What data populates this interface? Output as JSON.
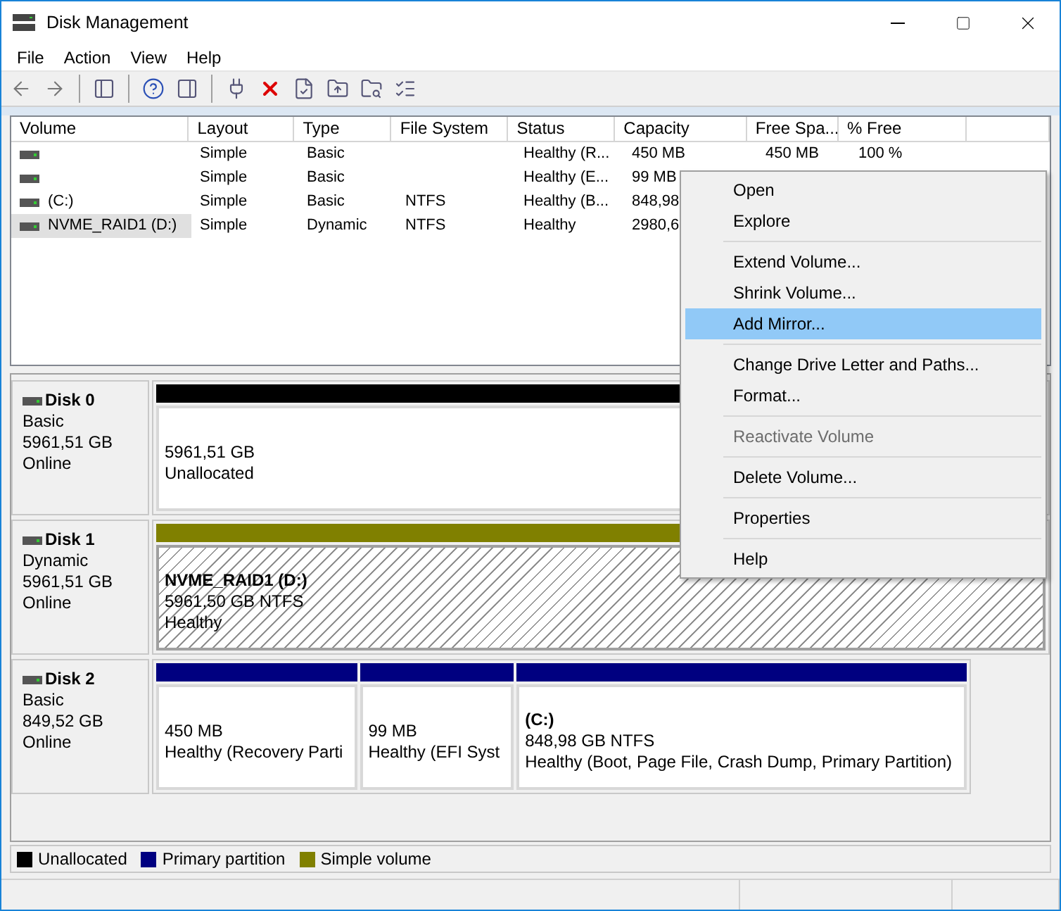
{
  "window": {
    "title": "Disk Management"
  },
  "menu_bar": [
    "File",
    "Action",
    "View",
    "Help"
  ],
  "volume_table": {
    "columns": [
      "Volume",
      "Layout",
      "Type",
      "File System",
      "Status",
      "Capacity",
      "Free Spa...",
      "% Free"
    ],
    "rows": [
      {
        "selected": false,
        "cells": [
          "",
          "Simple",
          "Basic",
          "",
          "Healthy (R...",
          "450 MB",
          "450 MB",
          "100 %"
        ]
      },
      {
        "selected": false,
        "cells": [
          "",
          "Simple",
          "Basic",
          "",
          "Healthy (E...",
          "99 MB"
        ]
      },
      {
        "selected": false,
        "cells": [
          "(C:)",
          "Simple",
          "Basic",
          "NTFS",
          "Healthy (B...",
          "848,98"
        ]
      },
      {
        "selected": true,
        "cells": [
          "NVME_RAID1 (D:)",
          "Simple",
          "Dynamic",
          "NTFS",
          "Healthy",
          "2980,6"
        ]
      }
    ]
  },
  "disks": [
    {
      "name": "Disk 0",
      "type": "Basic",
      "size": "5961,51 GB",
      "status": "Online",
      "partitions": [
        {
          "kind": "unallocated",
          "selected": false,
          "lines": [
            "5961,51 GB",
            "Unallocated"
          ]
        }
      ]
    },
    {
      "name": "Disk 1",
      "type": "Dynamic",
      "size": "5961,51 GB",
      "status": "Online",
      "partitions": [
        {
          "kind": "simple",
          "selected": true,
          "label": "NVME_RAID1  (D:)",
          "lines": [
            "5961,50 GB NTFS",
            "Healthy"
          ]
        }
      ]
    },
    {
      "name": "Disk 2",
      "type": "Basic",
      "size": "849,52 GB",
      "status": "Online",
      "partitions": [
        {
          "kind": "primary",
          "selected": false,
          "lines": [
            "450 MB",
            "Healthy (Recovery Parti"
          ]
        },
        {
          "kind": "primary",
          "selected": false,
          "lines": [
            "99 MB",
            "Healthy (EFI Syst"
          ]
        },
        {
          "kind": "primary",
          "selected": false,
          "label": "(C:)",
          "lines": [
            "848,98 GB NTFS",
            "Healthy (Boot, Page File, Crash Dump, Primary Partition)"
          ]
        }
      ]
    }
  ],
  "legend": [
    {
      "label": "Unallocated",
      "color": "#000000"
    },
    {
      "label": "Primary partition",
      "color": "#000080"
    },
    {
      "label": "Simple volume",
      "color": "#808000"
    }
  ],
  "context_menu": [
    {
      "kind": "item",
      "label": "Open",
      "selected": false,
      "disabled": false
    },
    {
      "kind": "item",
      "label": "Explore",
      "selected": false,
      "disabled": false
    },
    {
      "kind": "separator"
    },
    {
      "kind": "item",
      "label": "Extend Volume...",
      "selected": false,
      "disabled": false
    },
    {
      "kind": "item",
      "label": "Shrink Volume...",
      "selected": false,
      "disabled": false
    },
    {
      "kind": "item",
      "label": "Add Mirror...",
      "selected": true,
      "disabled": false
    },
    {
      "kind": "separator"
    },
    {
      "kind": "item",
      "label": "Change Drive Letter and Paths...",
      "selected": false,
      "disabled": false
    },
    {
      "kind": "item",
      "label": "Format...",
      "selected": false,
      "disabled": false
    },
    {
      "kind": "separator"
    },
    {
      "kind": "item",
      "label": "Reactivate Volume",
      "selected": false,
      "disabled": true
    },
    {
      "kind": "separator"
    },
    {
      "kind": "item",
      "label": "Delete Volume...",
      "selected": false,
      "disabled": false
    },
    {
      "kind": "separator"
    },
    {
      "kind": "item",
      "label": "Properties",
      "selected": false,
      "disabled": false
    },
    {
      "kind": "separator"
    },
    {
      "kind": "item",
      "label": "Help",
      "selected": false,
      "disabled": false
    }
  ]
}
